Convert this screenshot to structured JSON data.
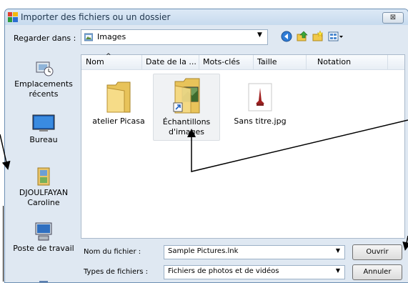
{
  "window": {
    "title": "Importer des fichiers ou un dossier",
    "close_label": "⊠"
  },
  "lookin": {
    "label": "Regarder dans :",
    "value": "Images"
  },
  "places": [
    {
      "label": "Emplacements récents"
    },
    {
      "label": "Bureau"
    },
    {
      "label": "DJOULFAYAN Caroline"
    },
    {
      "label": "Poste de travail"
    }
  ],
  "columns": [
    "Nom",
    "Date de la ...",
    "Mots-clés",
    "Taille",
    "Notation"
  ],
  "files": [
    {
      "name": "atelier Picasa",
      "icon": "folder-icon"
    },
    {
      "name": "Échantillons d'images",
      "icon": "folder-shortcut-icon",
      "selected": true
    },
    {
      "name": "Sans titre.jpg",
      "icon": "jpg-file-icon"
    }
  ],
  "filename": {
    "label": "Nom du fichier :",
    "value": "Sample Pictures.lnk"
  },
  "filetype": {
    "label": "Types de fichiers :",
    "value": "Fichiers de photos et de vidéos"
  },
  "buttons": {
    "open": "Ouvrir",
    "cancel": "Annuler"
  },
  "colors": {
    "dialog_bg": "#dfe8f2",
    "title_text": "#22384f",
    "annotation": "#000000"
  }
}
